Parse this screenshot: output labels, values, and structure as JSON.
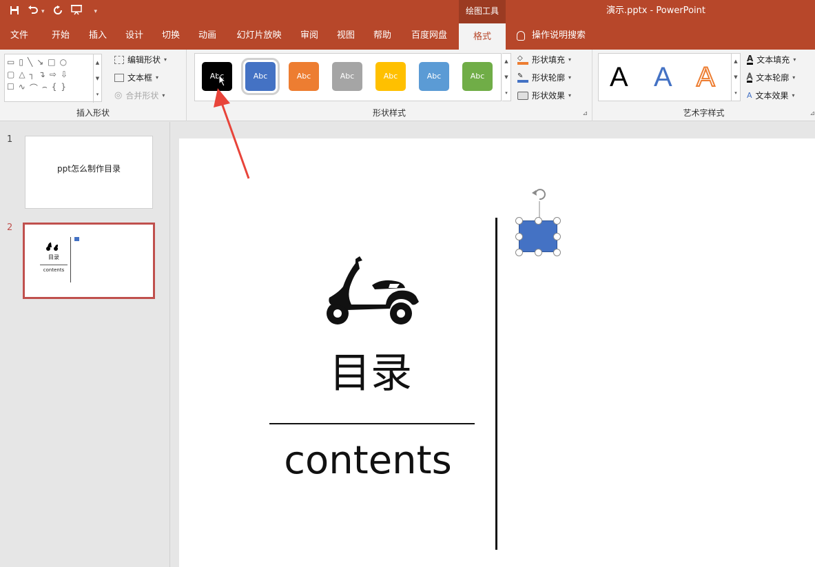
{
  "titlebar": {
    "context_tab_label": "绘图工具",
    "document_title": "演示.pptx  -  PowerPoint"
  },
  "tabs": [
    {
      "label": "文件"
    },
    {
      "label": "开始"
    },
    {
      "label": "插入"
    },
    {
      "label": "设计"
    },
    {
      "label": "切换"
    },
    {
      "label": "动画"
    },
    {
      "label": "幻灯片放映"
    },
    {
      "label": "审阅"
    },
    {
      "label": "视图"
    },
    {
      "label": "帮助"
    },
    {
      "label": "百度网盘"
    },
    {
      "label": "格式",
      "active": true
    }
  ],
  "tell_me": "操作说明搜索",
  "ribbon": {
    "insert_shapes": {
      "label": "插入形状",
      "edit_shape": "编辑形状",
      "text_box": "文本框",
      "merge_shapes": "合并形状"
    },
    "shape_styles": {
      "label": "形状样式",
      "swatch_text": "Abc",
      "swatches": [
        {
          "color": "#000000",
          "name": "black"
        },
        {
          "color": "#4472c4",
          "name": "blue"
        },
        {
          "color": "#ed7d31",
          "name": "orange"
        },
        {
          "color": "#a5a5a5",
          "name": "gray"
        },
        {
          "color": "#ffc000",
          "name": "gold"
        },
        {
          "color": "#5b9bd5",
          "name": "light-blue"
        },
        {
          "color": "#70ad47",
          "name": "green"
        }
      ],
      "shape_fill": "形状填充",
      "shape_outline": "形状轮廓",
      "shape_effects": "形状效果"
    },
    "wordart_styles": {
      "label": "艺术字样式",
      "sample_letter": "A",
      "text_fill": "文本填充",
      "text_outline": "文本轮廓",
      "text_effects": "文本效果"
    }
  },
  "thumbnails": [
    {
      "number": "1",
      "text": "ppt怎么制作目录"
    },
    {
      "number": "2",
      "title": "目录",
      "subtitle": "contents"
    }
  ],
  "slide": {
    "title": "目录",
    "subtitle": "contents"
  },
  "colors": {
    "accent": "#b7472a",
    "selected_shape": "#4472c4",
    "annotation_arrow": "#e8443a"
  }
}
